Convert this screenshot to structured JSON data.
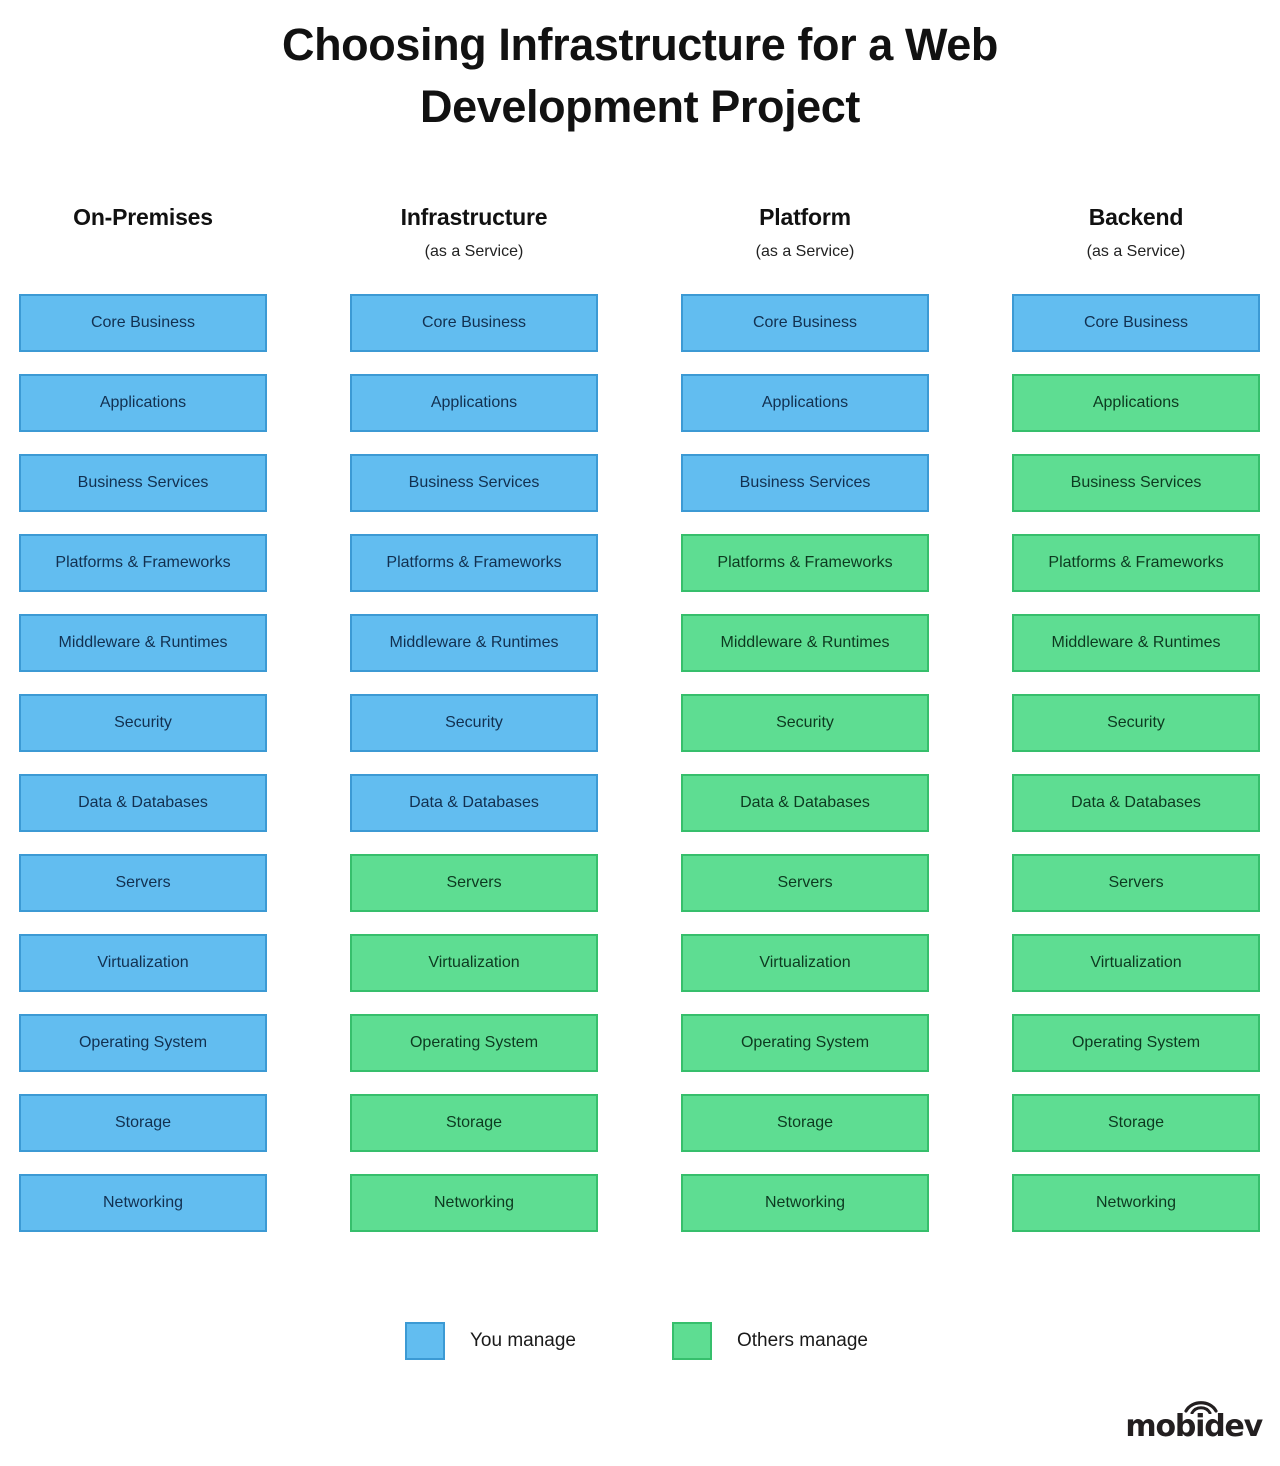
{
  "title": "Choosing Infrastructure for a Web Development Project",
  "title_line1": "Choosing Infrastructure for a Web",
  "title_line2": "Development Project",
  "colors": {
    "you_manage_fill": "#62bdf0",
    "you_manage_border": "#3c9ad4",
    "others_manage_fill": "#5edd92",
    "others_manage_border": "#36bf6c",
    "background": "#ffffff",
    "text": "#111111"
  },
  "layers": [
    "Core Business",
    "Applications",
    "Business Services",
    "Platforms & Frameworks",
    "Middleware & Runtimes",
    "Security",
    "Data & Databases",
    "Servers",
    "Virtualization",
    "Operating System",
    "Storage",
    "Networking"
  ],
  "columns": [
    {
      "title": "On-Premises",
      "subtitle": "",
      "cells": [
        {
          "label": "Core Business",
          "managed_by": "you"
        },
        {
          "label": "Applications",
          "managed_by": "you"
        },
        {
          "label": "Business Services",
          "managed_by": "you"
        },
        {
          "label": "Platforms & Frameworks",
          "managed_by": "you"
        },
        {
          "label": "Middleware & Runtimes",
          "managed_by": "you"
        },
        {
          "label": "Security",
          "managed_by": "you"
        },
        {
          "label": "Data & Databases",
          "managed_by": "you"
        },
        {
          "label": "Servers",
          "managed_by": "you"
        },
        {
          "label": "Virtualization",
          "managed_by": "you"
        },
        {
          "label": "Operating System",
          "managed_by": "you"
        },
        {
          "label": "Storage",
          "managed_by": "you"
        },
        {
          "label": "Networking",
          "managed_by": "you"
        }
      ]
    },
    {
      "title": "Infrastructure",
      "subtitle": "(as a Service)",
      "cells": [
        {
          "label": "Core Business",
          "managed_by": "you"
        },
        {
          "label": "Applications",
          "managed_by": "you"
        },
        {
          "label": "Business Services",
          "managed_by": "you"
        },
        {
          "label": "Platforms & Frameworks",
          "managed_by": "you"
        },
        {
          "label": "Middleware & Runtimes",
          "managed_by": "you"
        },
        {
          "label": "Security",
          "managed_by": "you"
        },
        {
          "label": "Data & Databases",
          "managed_by": "you"
        },
        {
          "label": "Servers",
          "managed_by": "others"
        },
        {
          "label": "Virtualization",
          "managed_by": "others"
        },
        {
          "label": "Operating System",
          "managed_by": "others"
        },
        {
          "label": "Storage",
          "managed_by": "others"
        },
        {
          "label": "Networking",
          "managed_by": "others"
        }
      ]
    },
    {
      "title": "Platform",
      "subtitle": "(as a Service)",
      "cells": [
        {
          "label": "Core Business",
          "managed_by": "you"
        },
        {
          "label": "Applications",
          "managed_by": "you"
        },
        {
          "label": "Business Services",
          "managed_by": "you"
        },
        {
          "label": "Platforms & Frameworks",
          "managed_by": "others"
        },
        {
          "label": "Middleware & Runtimes",
          "managed_by": "others"
        },
        {
          "label": "Security",
          "managed_by": "others"
        },
        {
          "label": "Data & Databases",
          "managed_by": "others"
        },
        {
          "label": "Servers",
          "managed_by": "others"
        },
        {
          "label": "Virtualization",
          "managed_by": "others"
        },
        {
          "label": "Operating System",
          "managed_by": "others"
        },
        {
          "label": "Storage",
          "managed_by": "others"
        },
        {
          "label": "Networking",
          "managed_by": "others"
        }
      ]
    },
    {
      "title": "Backend",
      "subtitle": "(as a Service)",
      "cells": [
        {
          "label": "Core Business",
          "managed_by": "you"
        },
        {
          "label": "Applications",
          "managed_by": "others"
        },
        {
          "label": "Business Services",
          "managed_by": "others"
        },
        {
          "label": "Platforms & Frameworks",
          "managed_by": "others"
        },
        {
          "label": "Middleware & Runtimes",
          "managed_by": "others"
        },
        {
          "label": "Security",
          "managed_by": "others"
        },
        {
          "label": "Data & Databases",
          "managed_by": "others"
        },
        {
          "label": "Servers",
          "managed_by": "others"
        },
        {
          "label": "Virtualization",
          "managed_by": "others"
        },
        {
          "label": "Operating System",
          "managed_by": "others"
        },
        {
          "label": "Storage",
          "managed_by": "others"
        },
        {
          "label": "Networking",
          "managed_by": "others"
        }
      ]
    }
  ],
  "legend": {
    "you": {
      "label": "You manage",
      "swatch": "you"
    },
    "others": {
      "label": "Others manage",
      "swatch": "others"
    }
  },
  "logo": {
    "wordmark": "mobidev",
    "icon": "wifi-arc-icon"
  }
}
